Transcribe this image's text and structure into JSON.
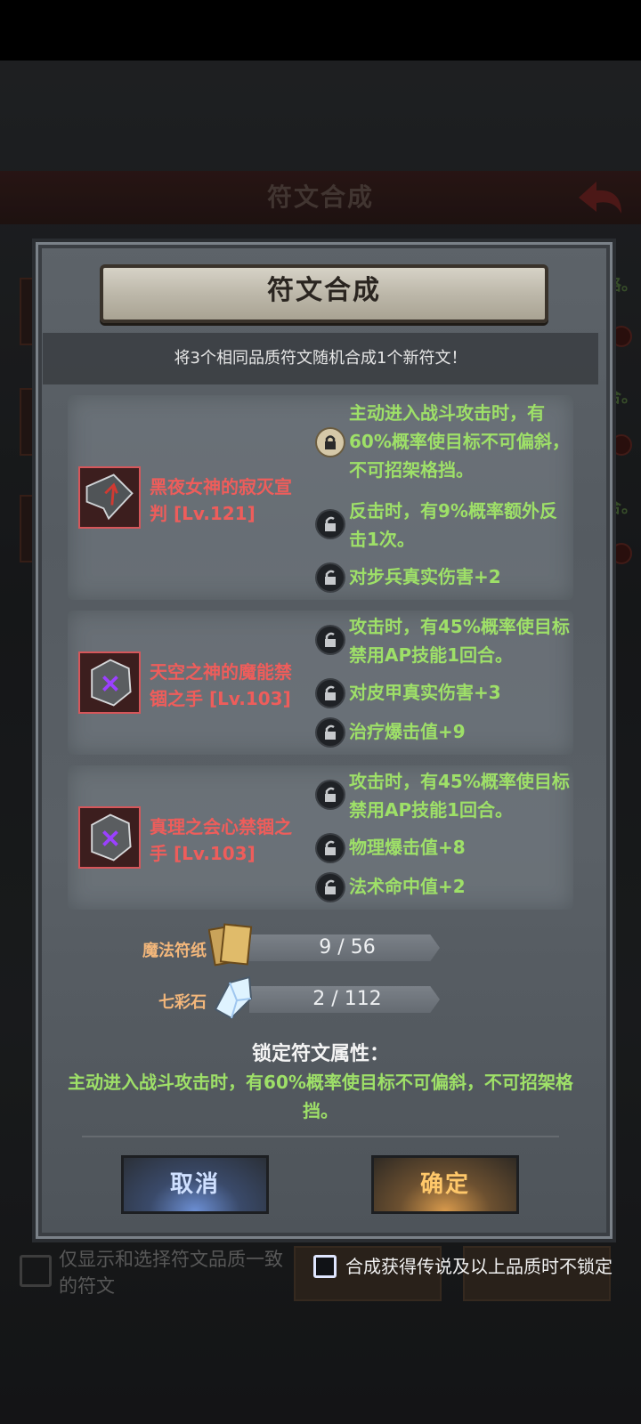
{
  "background": {
    "title": "符文合成",
    "filter_label": "仅显示和选择符文品质一致的符文"
  },
  "dialog": {
    "title": "符文合成",
    "subtitle": "将3个相同品质符文随机合成1个新符文！",
    "runes": [
      {
        "name": "黑夜女神的寂灭宣判 [Lv.121]",
        "icon": "shard-rune-icon",
        "attrs": [
          {
            "text": "主动进入战斗攻击时，有60%概率使目标不可偏斜，不可招架格挡。",
            "locked": true
          },
          {
            "text": "反击时，有9%概率额外反击1次。",
            "locked": false
          },
          {
            "text": "对步兵真实伤害+2",
            "locked": false
          }
        ]
      },
      {
        "name": "天空之神的魔能禁锢之手 [Lv.103]",
        "icon": "stone-rune-icon",
        "attrs": [
          {
            "text": "攻击时，有45%概率使目标禁用AP技能1回合。",
            "locked": false
          },
          {
            "text": "对皮甲真实伤害+3",
            "locked": false
          },
          {
            "text": "治疗爆击值+9",
            "locked": false
          }
        ]
      },
      {
        "name": "真理之会心禁锢之手 [Lv.103]",
        "icon": "stone-rune-icon",
        "attrs": [
          {
            "text": "攻击时，有45%概率使目标禁用AP技能1回合。",
            "locked": false
          },
          {
            "text": "物理爆击值+8",
            "locked": false
          },
          {
            "text": "法术命中值+2",
            "locked": false
          }
        ]
      }
    ],
    "costs": [
      {
        "label": "魔法符纸",
        "value": "9 / 56",
        "icon": "paper-scroll-icon"
      },
      {
        "label": "七彩石",
        "value": "2 / 112",
        "icon": "crystal-icon"
      }
    ],
    "lock_heading": "锁定符文属性：",
    "lock_text": "主动进入战斗攻击时，有60%概率使目标不可偏斜，不可招架格挡。",
    "cancel_label": "取消",
    "confirm_label": "确定"
  },
  "keep_option": {
    "label": "合成获得传说及以上品质时不锁定",
    "checked": false
  },
  "colors": {
    "rune_name": "#ee5d5b",
    "attr_text": "#9ee068",
    "cost_label": "#f3b77b"
  }
}
